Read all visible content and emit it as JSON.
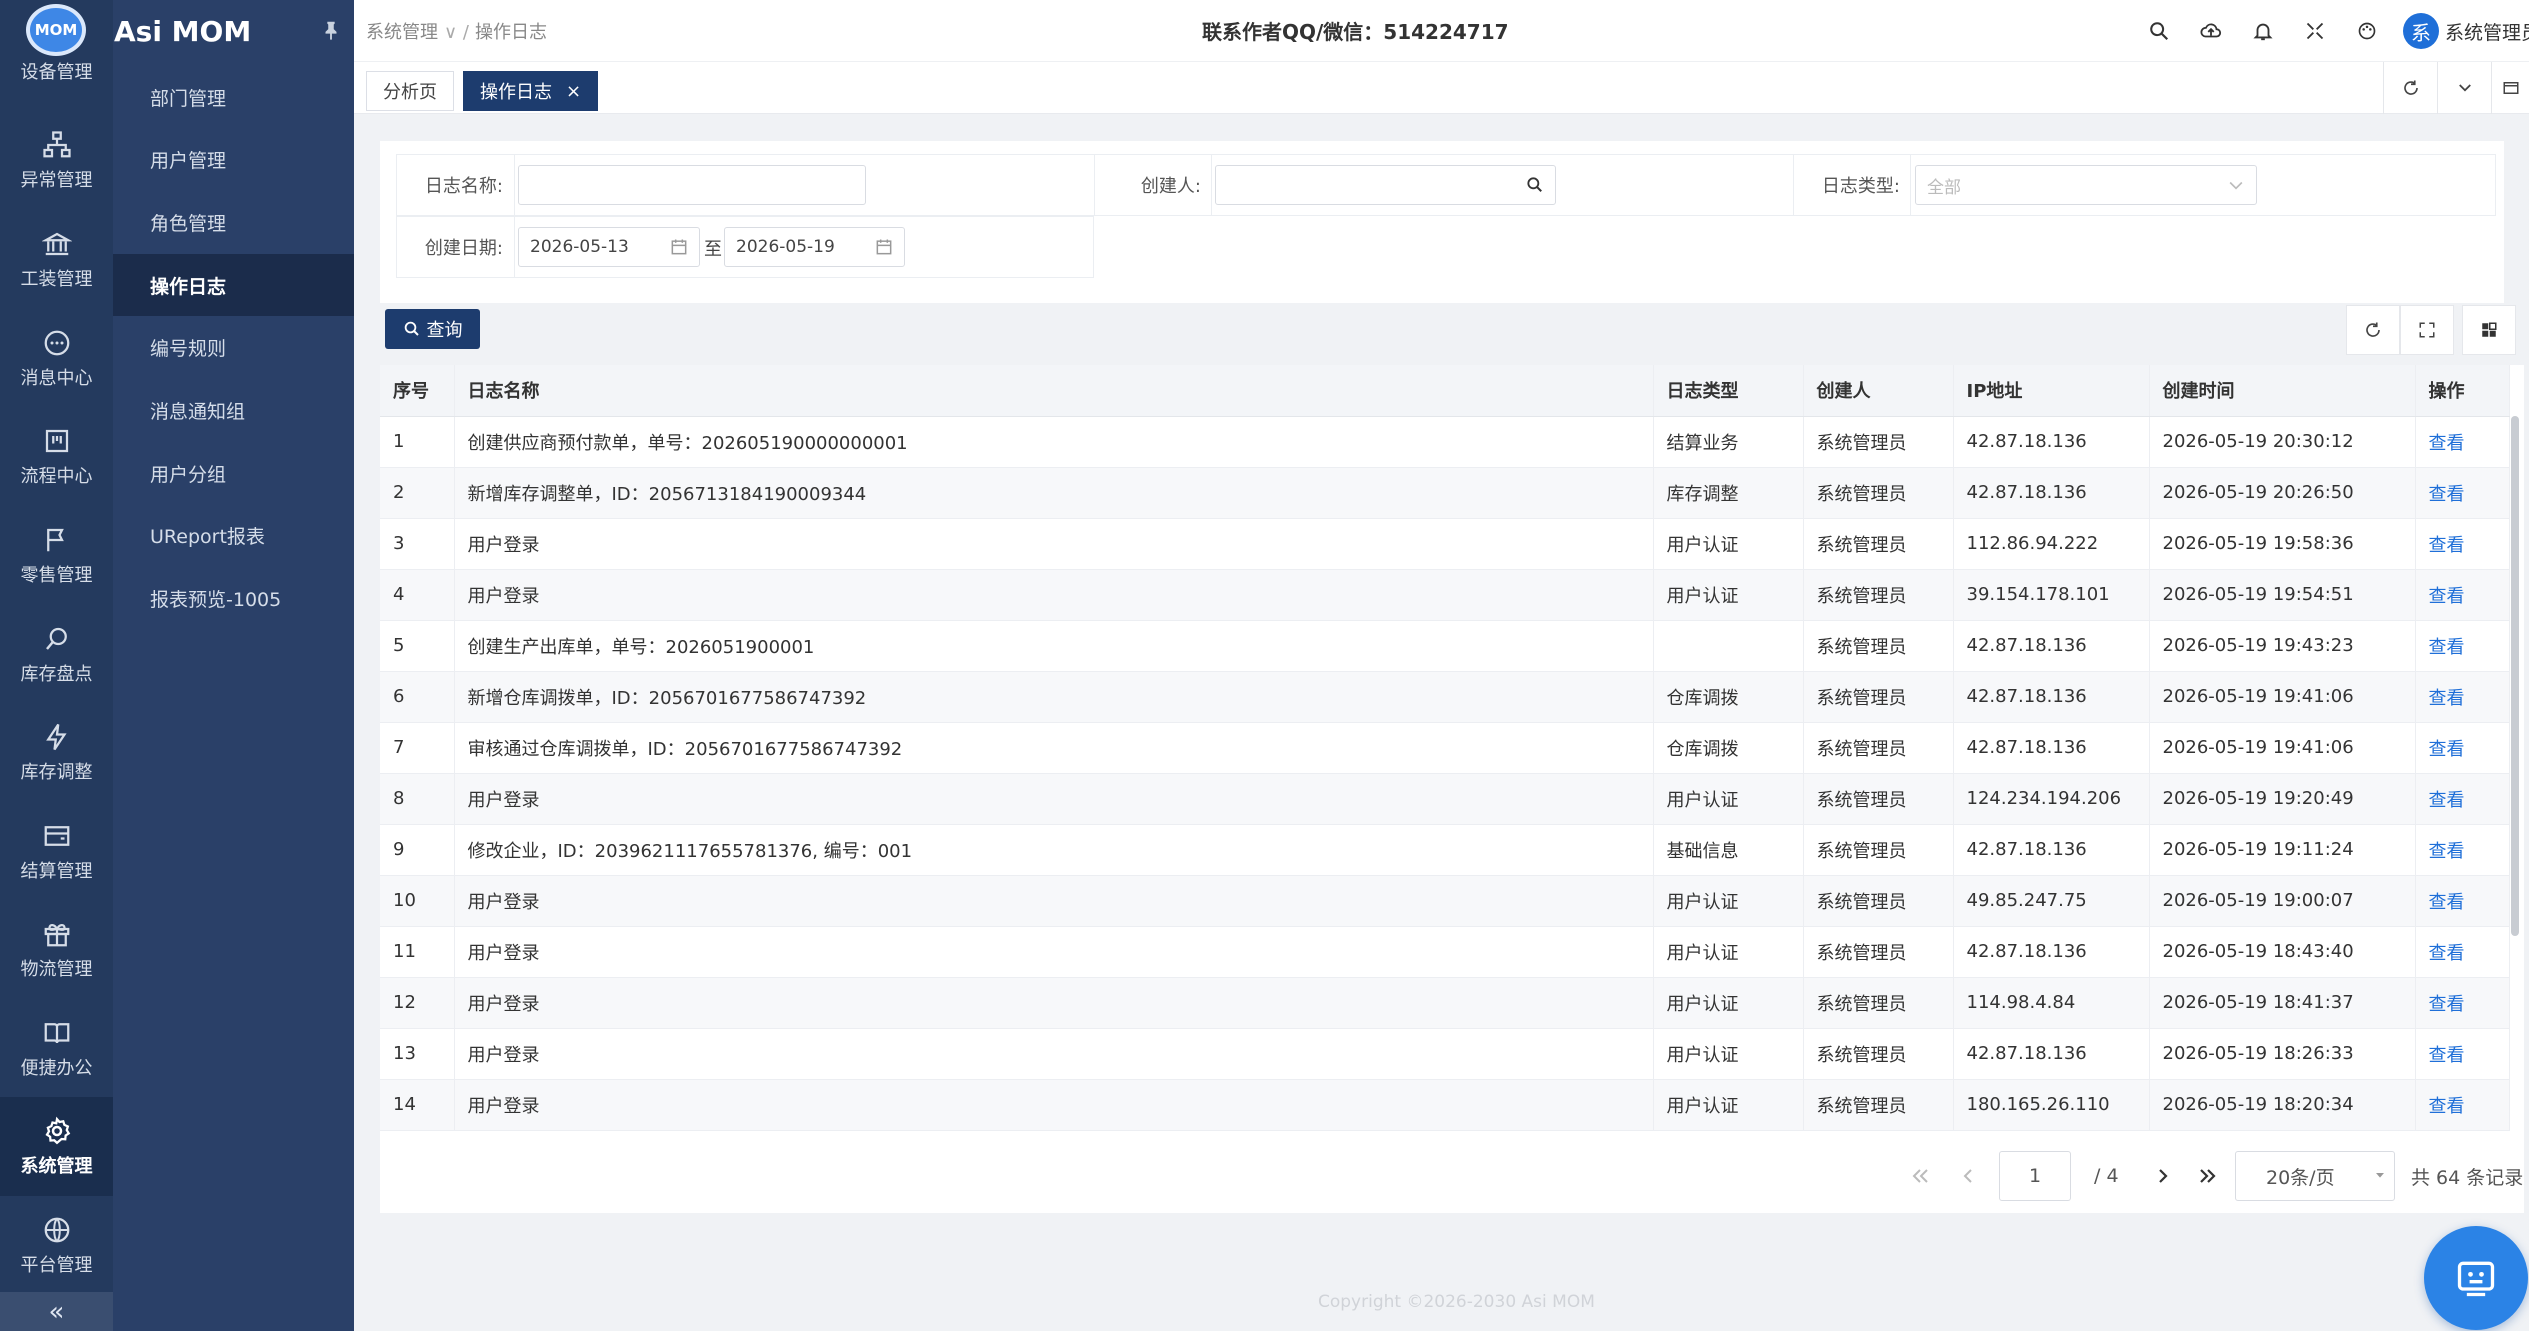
{
  "app": {
    "brand": "Asi MOM",
    "logo_text": "MOM"
  },
  "rail": {
    "items": [
      {
        "label": "设备管理",
        "icon": "device-icon"
      },
      {
        "label": "异常管理",
        "icon": "org-chart-icon"
      },
      {
        "label": "工装管理",
        "icon": "bank-icon"
      },
      {
        "label": "消息中心",
        "icon": "message-icon"
      },
      {
        "label": "流程中心",
        "icon": "flow-icon"
      },
      {
        "label": "零售管理",
        "icon": "flag-icon"
      },
      {
        "label": "库存盘点",
        "icon": "search-icon"
      },
      {
        "label": "库存调整",
        "icon": "bolt-icon"
      },
      {
        "label": "结算管理",
        "icon": "wallet-icon"
      },
      {
        "label": "物流管理",
        "icon": "gift-icon"
      },
      {
        "label": "便捷办公",
        "icon": "book-icon"
      },
      {
        "label": "系统管理",
        "icon": "gear-icon",
        "active": true
      },
      {
        "label": "平台管理",
        "icon": "globe-icon"
      }
    ],
    "collapse": "«"
  },
  "submenu": {
    "items": [
      "部门管理",
      "用户管理",
      "角色管理",
      "操作日志",
      "编号规则",
      "消息通知组",
      "用户分组",
      "UReport报表",
      "报表预览-1005"
    ],
    "active": "操作日志"
  },
  "header": {
    "breadcrumb": [
      "系统管理",
      "操作日志"
    ],
    "contact": "联系作者QQ/微信：514224717",
    "user": "系统管理员",
    "avatar": "系"
  },
  "tabs": [
    {
      "label": "分析页"
    },
    {
      "label": "操作日志",
      "active": true,
      "close": "×"
    }
  ],
  "filters": {
    "log_name_label": "日志名称:",
    "log_name_value": "",
    "creator_label": "创建人:",
    "creator_value": "",
    "log_type_label": "日志类型:",
    "log_type_value": "全部",
    "date_label": "创建日期:",
    "date_start": "2026-05-13",
    "date_sep": "至",
    "date_end": "2026-05-19",
    "query_button": "查询"
  },
  "table": {
    "columns": [
      "序号",
      "日志名称",
      "日志类型",
      "创建人",
      "IP地址",
      "创建时间",
      "操作"
    ],
    "rows": [
      [
        "1",
        "创建供应商预付款单，单号：202605190000000001",
        "结算业务",
        "系统管理员",
        "42.87.18.136",
        "2026-05-19 20:30:12",
        "查看"
      ],
      [
        "2",
        "新增库存调整单，ID：2056713184190009344",
        "库存调整",
        "系统管理员",
        "42.87.18.136",
        "2026-05-19 20:26:50",
        "查看"
      ],
      [
        "3",
        "用户登录",
        "用户认证",
        "系统管理员",
        "112.86.94.222",
        "2026-05-19 19:58:36",
        "查看"
      ],
      [
        "4",
        "用户登录",
        "用户认证",
        "系统管理员",
        "39.154.178.101",
        "2026-05-19 19:54:51",
        "查看"
      ],
      [
        "5",
        "创建生产出库单，单号：2026051900001",
        "",
        "系统管理员",
        "42.87.18.136",
        "2026-05-19 19:43:23",
        "查看"
      ],
      [
        "6",
        "新增仓库调拨单，ID：2056701677586747392",
        "仓库调拨",
        "系统管理员",
        "42.87.18.136",
        "2026-05-19 19:41:06",
        "查看"
      ],
      [
        "7",
        "审核通过仓库调拨单，ID：2056701677586747392",
        "仓库调拨",
        "系统管理员",
        "42.87.18.136",
        "2026-05-19 19:41:06",
        "查看"
      ],
      [
        "8",
        "用户登录",
        "用户认证",
        "系统管理员",
        "124.234.194.206",
        "2026-05-19 19:20:49",
        "查看"
      ],
      [
        "9",
        "修改企业，ID：2039621117655781376, 编号：001",
        "基础信息",
        "系统管理员",
        "42.87.18.136",
        "2026-05-19 19:11:24",
        "查看"
      ],
      [
        "10",
        "用户登录",
        "用户认证",
        "系统管理员",
        "49.85.247.75",
        "2026-05-19 19:00:07",
        "查看"
      ],
      [
        "11",
        "用户登录",
        "用户认证",
        "系统管理员",
        "42.87.18.136",
        "2026-05-19 18:43:40",
        "查看"
      ],
      [
        "12",
        "用户登录",
        "用户认证",
        "系统管理员",
        "114.98.4.84",
        "2026-05-19 18:41:37",
        "查看"
      ],
      [
        "13",
        "用户登录",
        "用户认证",
        "系统管理员",
        "42.87.18.136",
        "2026-05-19 18:26:33",
        "查看"
      ],
      [
        "14",
        "用户登录",
        "用户认证",
        "系统管理员",
        "180.165.26.110",
        "2026-05-19 18:20:34",
        "查看"
      ]
    ]
  },
  "pagination": {
    "current": "1",
    "total_pages": "/ 4",
    "page_size": "20条/页",
    "total": "共 64 条记录"
  },
  "footer": {
    "copyright": "Copyright ©2026-2030 Asi MOM"
  },
  "colors": {
    "rail": "#243a5e",
    "submenu": "#2a4068",
    "primary": "#1d3c6e",
    "link": "#1f6fd8"
  }
}
